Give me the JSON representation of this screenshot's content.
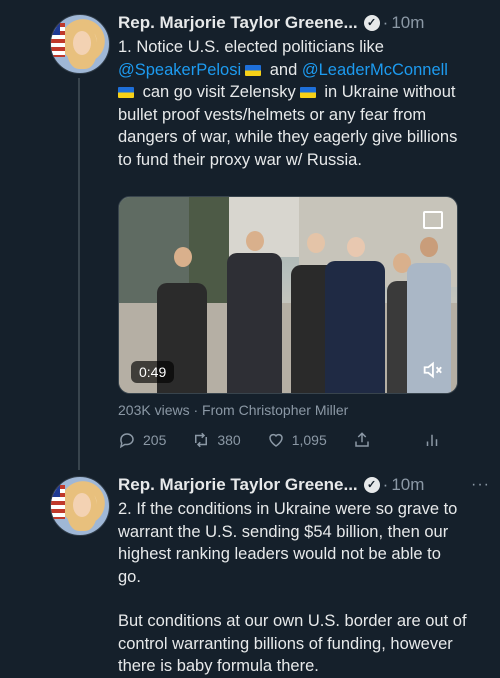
{
  "tweets": [
    {
      "author": "Rep. Marjorie Taylor Greene...",
      "time": "10m",
      "text_line1": "1. Notice U.S. elected politicians like",
      "mention1": "@SpeakerPelosi",
      "and_word": "and",
      "mention2": "@LeaderMcConnell",
      "text_rest_a": "can go visit Zelensky",
      "text_rest_b": "in Ukraine without bullet proof vests/helmets or any fear from dangers of war, while they eagerly give billions to fund their proxy war w/ Russia.",
      "video_duration": "0:49",
      "views_text": "203K views · From Christopher Miller",
      "replies": "205",
      "retweets": "380",
      "likes": "1,095"
    },
    {
      "author": "Rep. Marjorie Taylor Greene...",
      "time": "10m",
      "more": "···",
      "para1": "2. If the conditions in Ukraine were so grave to warrant the U.S. sending $54 billion, then our highest ranking leaders would not be able to go.",
      "para2": "But conditions at our own U.S. border are out of control warranting billions of funding, however there is baby formula there."
    }
  ],
  "colors": {
    "background": "#15202b",
    "text": "#e7e9ea",
    "secondary": "#8b98a5",
    "link": "#1d9bf0"
  },
  "icons": [
    "reply-icon",
    "retweet-icon",
    "like-icon",
    "share-icon",
    "analytics-icon",
    "verified-icon",
    "mute-icon",
    "ukraine-flag-icon"
  ]
}
